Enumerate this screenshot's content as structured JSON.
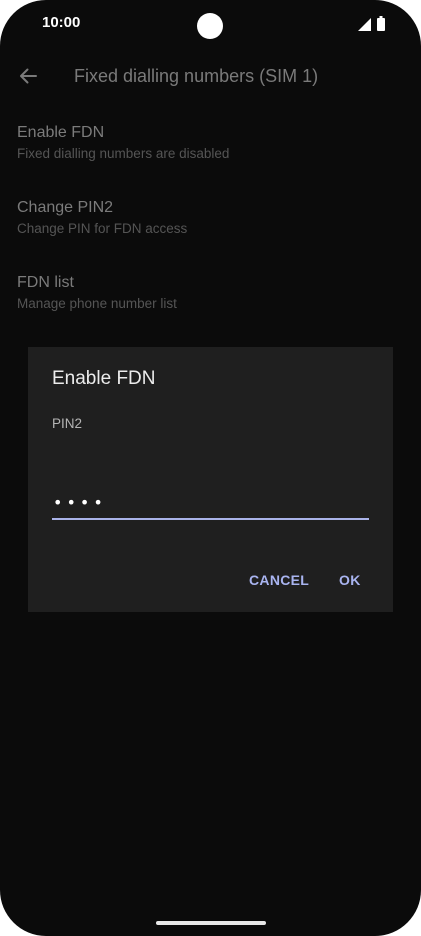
{
  "status_bar": {
    "time": "10:00"
  },
  "app_bar": {
    "title": "Fixed dialling numbers (SIM 1)",
    "back_icon": "arrow-back-icon"
  },
  "preferences": [
    {
      "title": "Enable FDN",
      "summary": "Fixed dialling numbers are disabled"
    },
    {
      "title": "Change PIN2",
      "summary": "Change PIN for FDN access"
    },
    {
      "title": "FDN list",
      "summary": "Manage phone number list"
    }
  ],
  "dialog": {
    "title": "Enable FDN",
    "label": "PIN2",
    "pin_value": "••••",
    "cancel_label": "CANCEL",
    "ok_label": "OK"
  },
  "colors": {
    "background": "#0b0b0b",
    "dialog_background": "#1f1f1f",
    "accent": "#a9b4f0"
  }
}
